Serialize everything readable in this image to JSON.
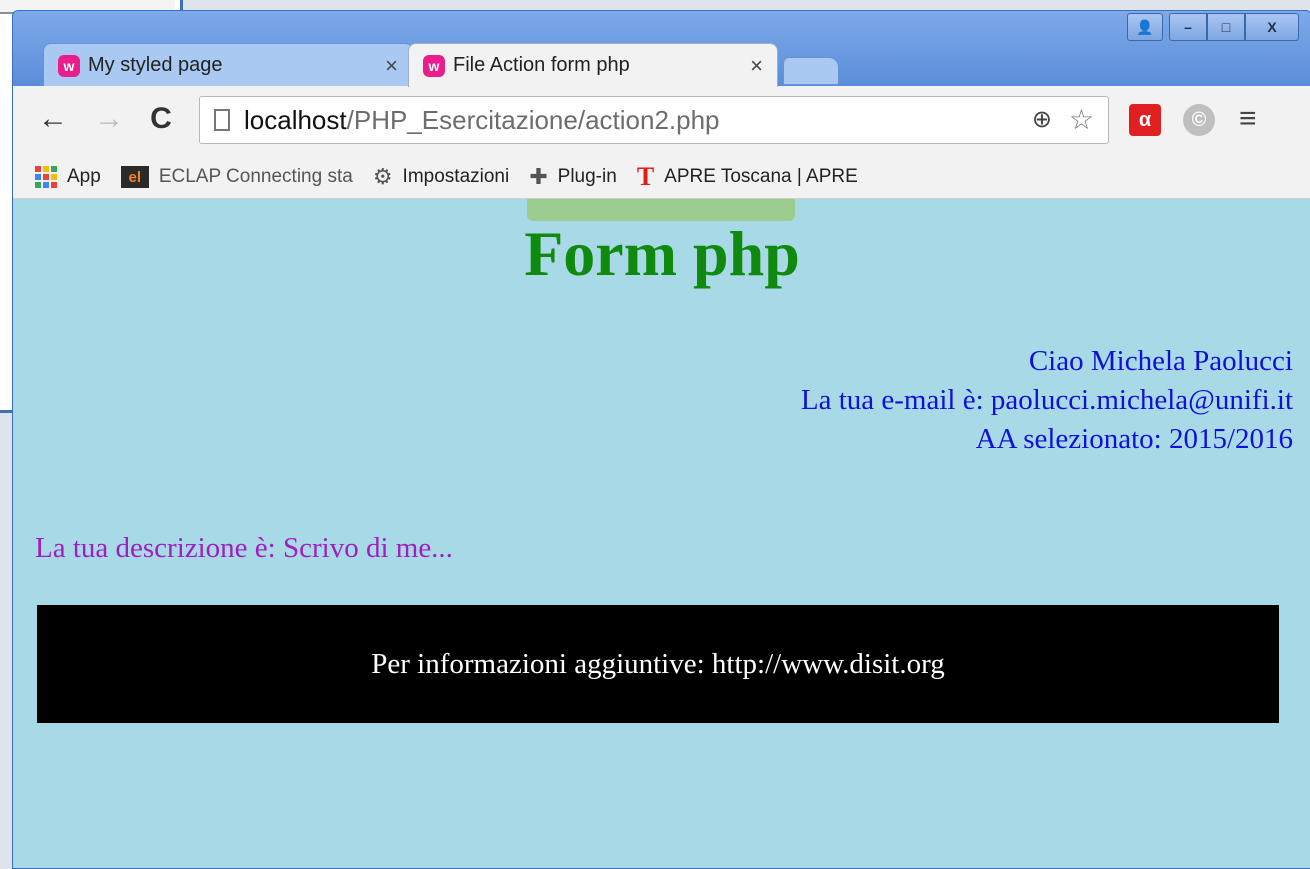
{
  "window": {
    "controls": {
      "user": "👤",
      "minimize": "–",
      "maximize": "□",
      "close": "X"
    }
  },
  "tabs": [
    {
      "title": "My styled page",
      "close": "×",
      "active": false
    },
    {
      "title": "File Action form php",
      "close": "×",
      "active": true
    }
  ],
  "toolbar": {
    "back": "←",
    "forward": "→",
    "reload": "C",
    "url_host": "localhost",
    "url_path": "/PHP_Esercitazione/action2.php",
    "zoom": "⊕",
    "star": "☆",
    "avira": "ᐧ",
    "menu": "≡"
  },
  "bookmarks": [
    {
      "label": "App",
      "icon": "apps-grid-icon"
    },
    {
      "label": "ECLAP Connecting sta",
      "icon": "eclap-icon"
    },
    {
      "label": "Impostazioni",
      "icon": "gear-icon"
    },
    {
      "label": "Plug-in",
      "icon": "puzzle-icon"
    },
    {
      "label": "APRE Toscana | APRE",
      "icon": "apre-icon"
    }
  ],
  "page": {
    "title": "Form php",
    "greeting_line1": "Ciao Michela Paolucci",
    "greeting_line2": "La tua e-mail è: paolucci.michela@unifi.it",
    "greeting_line3": "AA selezionato: 2015/2016",
    "description": "La tua descrizione è: Scrivo di me...",
    "footer": "Per informazioni aggiuntive: http://www.disit.org"
  },
  "colors": {
    "page_background": "#a8d9e6",
    "title_color": "#0f8a0f",
    "greeting_color": "#1010d8",
    "description_color": "#a01fc0",
    "footer_background": "#000000",
    "footer_text": "#ffffff"
  }
}
